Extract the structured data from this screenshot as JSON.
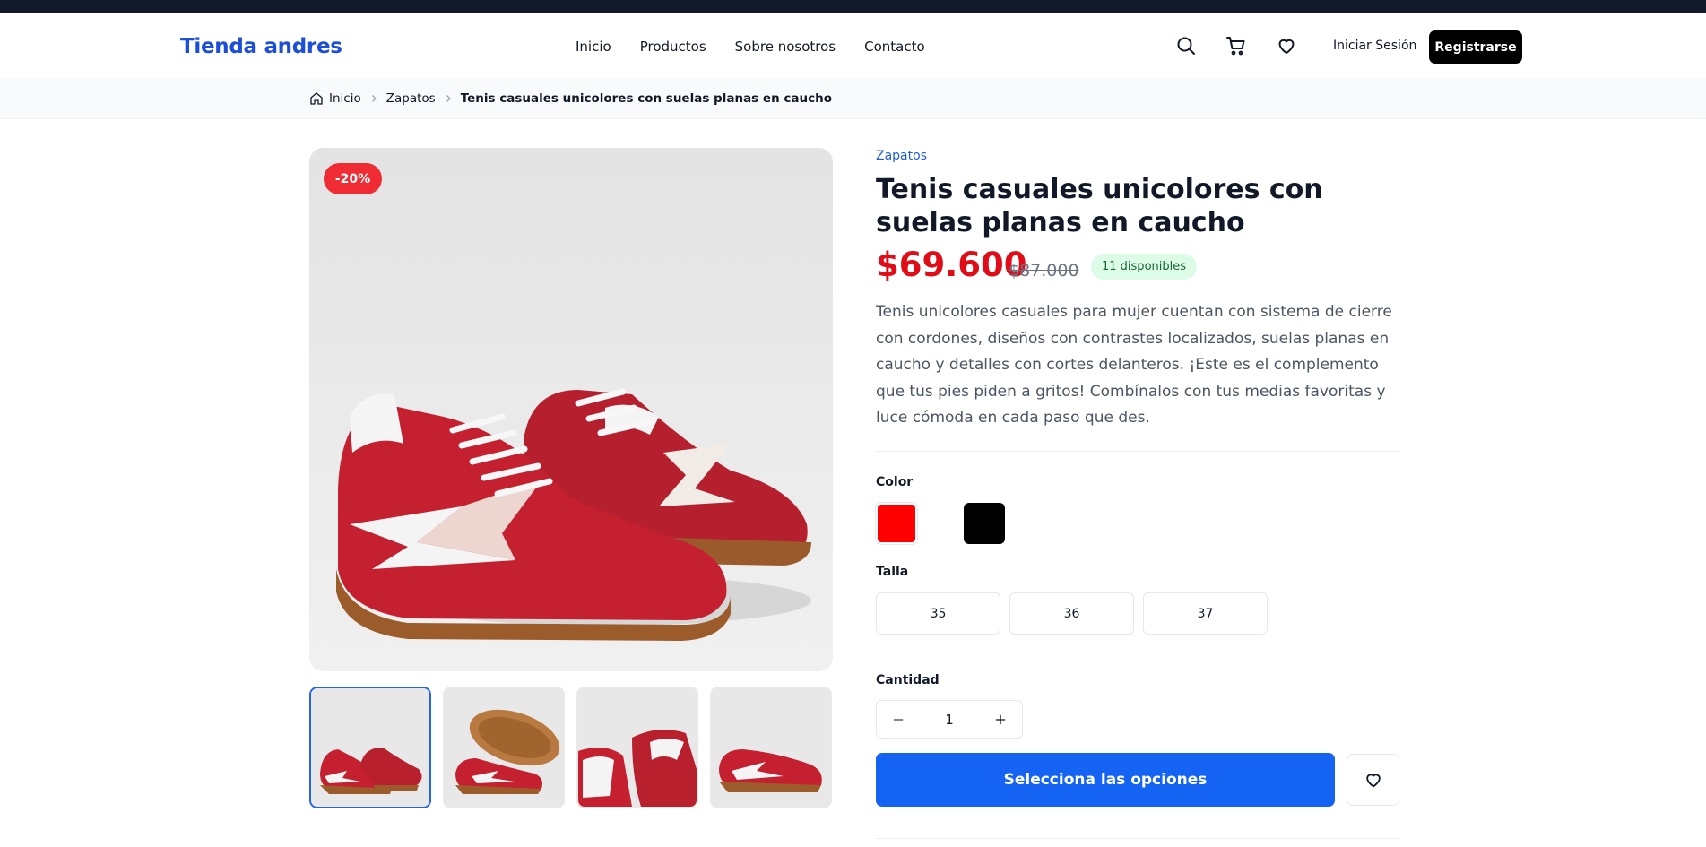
{
  "header": {
    "logo": "Tienda andres",
    "nav": [
      "Inicio",
      "Productos",
      "Sobre nosotros",
      "Contacto"
    ],
    "login_label": "Iniciar Sesión",
    "register_label": "Registrarse"
  },
  "breadcrumb": {
    "items": [
      "Inicio",
      "Zapatos",
      "Tenis casuales unicolores con suelas planas en caucho"
    ]
  },
  "gallery": {
    "discount_badge": "-20%",
    "thumbnail_count": 4,
    "active_thumbnail": 1
  },
  "product": {
    "category": "Zapatos",
    "title": "Tenis casuales unicolores con suelas planas en caucho",
    "price": "$69.600",
    "old_price": "$87.000",
    "stock": "11 disponibles",
    "description": "Tenis unicolores casuales para mujer cuentan con sistema de cierre con cordones, diseños con contrastes localizados, suelas planas en caucho y detalles con cortes delanteros. ¡Este es el complemento que tus pies piden a gritos! Combínalos con tus medias favoritas y luce cómoda en cada paso que des."
  },
  "options": {
    "color_label": "Color",
    "colors": [
      "#ff0000",
      "#000000"
    ],
    "size_label": "Talla",
    "sizes": [
      "35",
      "36",
      "37"
    ],
    "quantity_label": "Cantidad",
    "quantity": "1"
  },
  "actions": {
    "cta_label": "Selecciona las opciones"
  },
  "colors": {
    "brand": "#1d4ed8",
    "cta": "#1463f3",
    "price": "#e00d18",
    "badge": "#ef2b34"
  }
}
